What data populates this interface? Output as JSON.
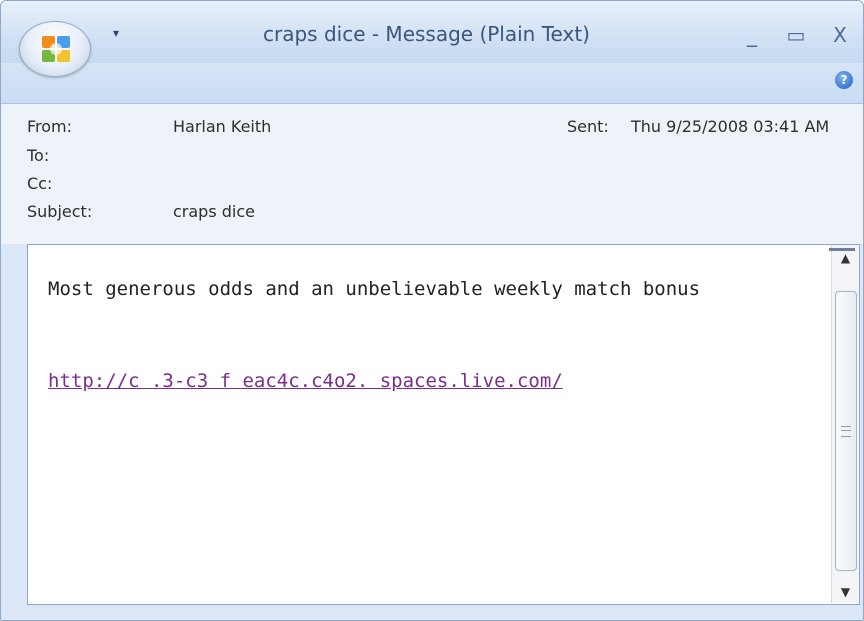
{
  "window": {
    "title": "craps dice - Message (Plain Text)",
    "controls": {
      "minimize": "_",
      "maximize": "▭",
      "close": "X"
    },
    "help_glyph": "?"
  },
  "header": {
    "from_label": "From:",
    "from_value": "Harlan Keith",
    "to_label": "To:",
    "cc_label": "Cc:",
    "subject_label": "Subject:",
    "subject_value": "craps dice",
    "sent_label": "Sent:",
    "sent_value": "Thu 9/25/2008 03:41 AM"
  },
  "message": {
    "body": "Most generous odds and an unbelievable weekly match bonus",
    "link": "http://c  .3-c3  f  eac4c.c4o2.  spaces.live.com/"
  },
  "colors": {
    "accent": "#2b4a78",
    "link": "#7a2f8a",
    "title_text": "#3c5679"
  },
  "icons": [
    "office-button-icon",
    "quick-access-arrow-icon",
    "help-icon",
    "scroll-up-icon",
    "scroll-down-icon",
    "scroll-grip-icon"
  ]
}
